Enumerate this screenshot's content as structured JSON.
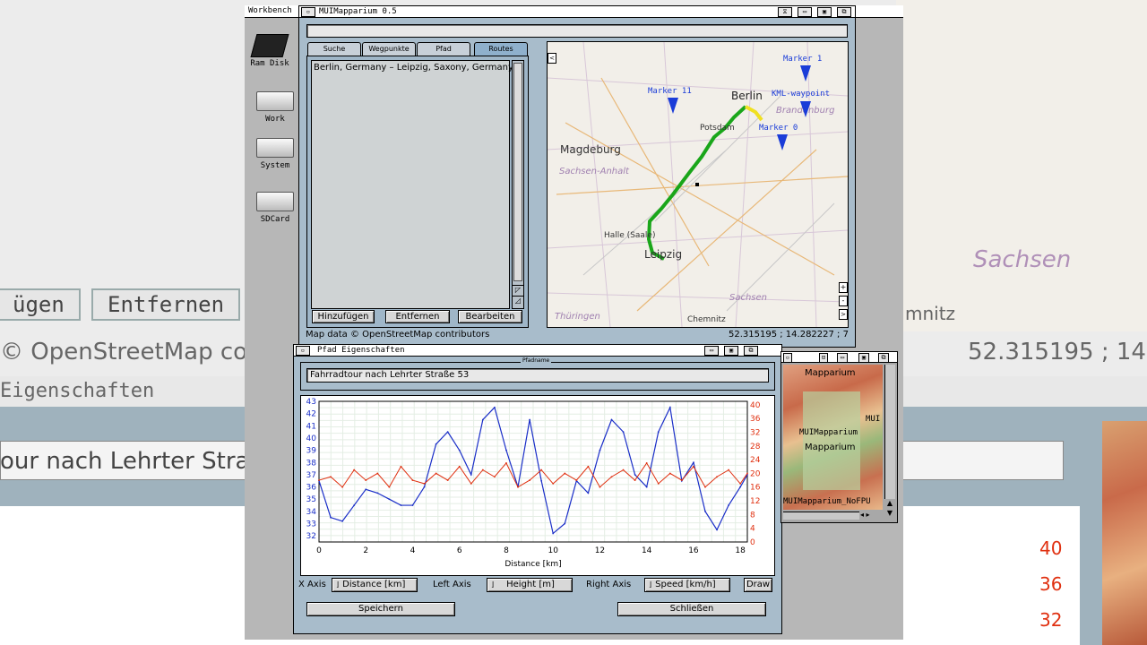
{
  "background": {
    "buttons": [
      "ügen",
      "Entfernen"
    ],
    "credit": "© OpenStreetMap con",
    "coords": "52.315195 ; 14.2",
    "section": "Eigenschaften",
    "path_field": "our nach Lehrter Stra",
    "map_region": "Sachsen",
    "map_city": "mnitz",
    "ticks": [
      "40",
      "36",
      "32"
    ]
  },
  "workbench": {
    "title": "Workbench",
    "icons": [
      "Ram Disk",
      "Work",
      "System",
      "SDCard"
    ]
  },
  "main_window": {
    "title": "MUIMapparium 0.5",
    "tabs": [
      "Suche",
      "Wegpunkte",
      "Pfad",
      "Routes"
    ],
    "active_tab": "Routes",
    "route_item": "Berlin, Germany – Leipzig, Saxony, Germany",
    "buttons": {
      "add": "Hinzufügen",
      "remove": "Entfernen",
      "edit": "Bearbeiten"
    },
    "status_credit": "Map data © OpenStreetMap contributors",
    "status_coords": "52.315195 ; 14.282227 ; 7",
    "map_labels": {
      "berlin": "Berlin",
      "potsdam": "Potsdam",
      "brandenburg": "Brandenburg",
      "magdeburg": "Magdeburg",
      "sachsen_anhalt": "Sachsen-Anhalt",
      "halle": "Halle (Saale)",
      "leipzig": "Leipzig",
      "sachsen": "Sachsen",
      "thueringen": "Thüringen",
      "chemnitz": "Chemnitz"
    },
    "markers": [
      "Marker 1",
      "Marker 11",
      "KML-waypoint",
      "Marker 0"
    ],
    "map_colors": {
      "route": "#1aa61a",
      "segment": "#f0e020",
      "marker": "#1a3cd8"
    }
  },
  "path_window": {
    "title": "Pfad Eigenschaften",
    "name_label": "Pfadname",
    "path_name": "Fahrradtour nach Lehrter Straße 53",
    "x_axis_label": "X Axis",
    "x_axis_value": "Distance [km]",
    "left_axis_label": "Left Axis",
    "left_axis_value": "Height [m]",
    "right_axis_label": "Right Axis",
    "right_axis_value": "Speed [km/h]",
    "draw": "Draw",
    "save": "Speichern",
    "close": "Schließen"
  },
  "chart_data": {
    "type": "line",
    "xlabel": "Distance [km]",
    "xlim": [
      0,
      18.3
    ],
    "ylim_left": [
      31.5,
      43
    ],
    "ylim_right": [
      0,
      41
    ],
    "x_ticks": [
      "0",
      "2",
      "4",
      "6",
      "8",
      "10",
      "12",
      "14",
      "16",
      "18"
    ],
    "y_left_ticks": [
      "32",
      "33",
      "34",
      "35",
      "36",
      "37",
      "38",
      "39",
      "40",
      "41",
      "42",
      "43"
    ],
    "y_right_ticks": [
      "0",
      "4",
      "8",
      "12",
      "16",
      "20",
      "24",
      "28",
      "32",
      "36",
      "40"
    ],
    "series": [
      {
        "axis": "left",
        "color": "#1a2ec8",
        "x": [
          0,
          0.5,
          1,
          1.5,
          2,
          2.5,
          3,
          3.5,
          4,
          4.5,
          5,
          5.5,
          6,
          6.5,
          7,
          7.5,
          8,
          8.5,
          9,
          9.5,
          10,
          10.5,
          11,
          11.5,
          12,
          12.5,
          13,
          13.5,
          14,
          14.5,
          15,
          15.5,
          16,
          16.5,
          17,
          17.5,
          18,
          18.3
        ],
        "values": [
          36.5,
          33.5,
          33.2,
          34.5,
          35.8,
          35.5,
          35.0,
          34.5,
          34.5,
          36.0,
          39.5,
          40.5,
          39.0,
          37.0,
          41.5,
          42.5,
          39.0,
          36.0,
          41.5,
          36.5,
          32.2,
          33.0,
          36.5,
          35.5,
          39.0,
          41.5,
          40.5,
          37.0,
          36.0,
          40.5,
          42.5,
          36.5,
          38.0,
          34.0,
          32.5,
          34.5,
          36.0,
          37.0
        ]
      },
      {
        "axis": "right",
        "color": "#e03010",
        "x": [
          0,
          0.5,
          1,
          1.5,
          2,
          2.5,
          3,
          3.5,
          4,
          4.5,
          5,
          5.5,
          6,
          6.5,
          7,
          7.5,
          8,
          8.5,
          9,
          9.5,
          10,
          10.5,
          11,
          11.5,
          12,
          12.5,
          13,
          13.5,
          14,
          14.5,
          15,
          15.5,
          16,
          16.5,
          17,
          17.5,
          18,
          18.3
        ],
        "values": [
          18,
          19,
          16,
          21,
          18,
          20,
          16,
          22,
          18,
          17,
          20,
          18,
          22,
          17,
          21,
          19,
          23,
          16,
          18,
          21,
          17,
          20,
          18,
          22,
          16,
          19,
          21,
          18,
          23,
          17,
          20,
          18,
          22,
          16,
          19,
          21,
          17,
          20
        ]
      }
    ]
  },
  "side_window": {
    "labels": [
      "Mapparium",
      "MUI",
      "MUIMapparium",
      "Mapparium",
      "MUIMapparium_NoFPU"
    ]
  }
}
